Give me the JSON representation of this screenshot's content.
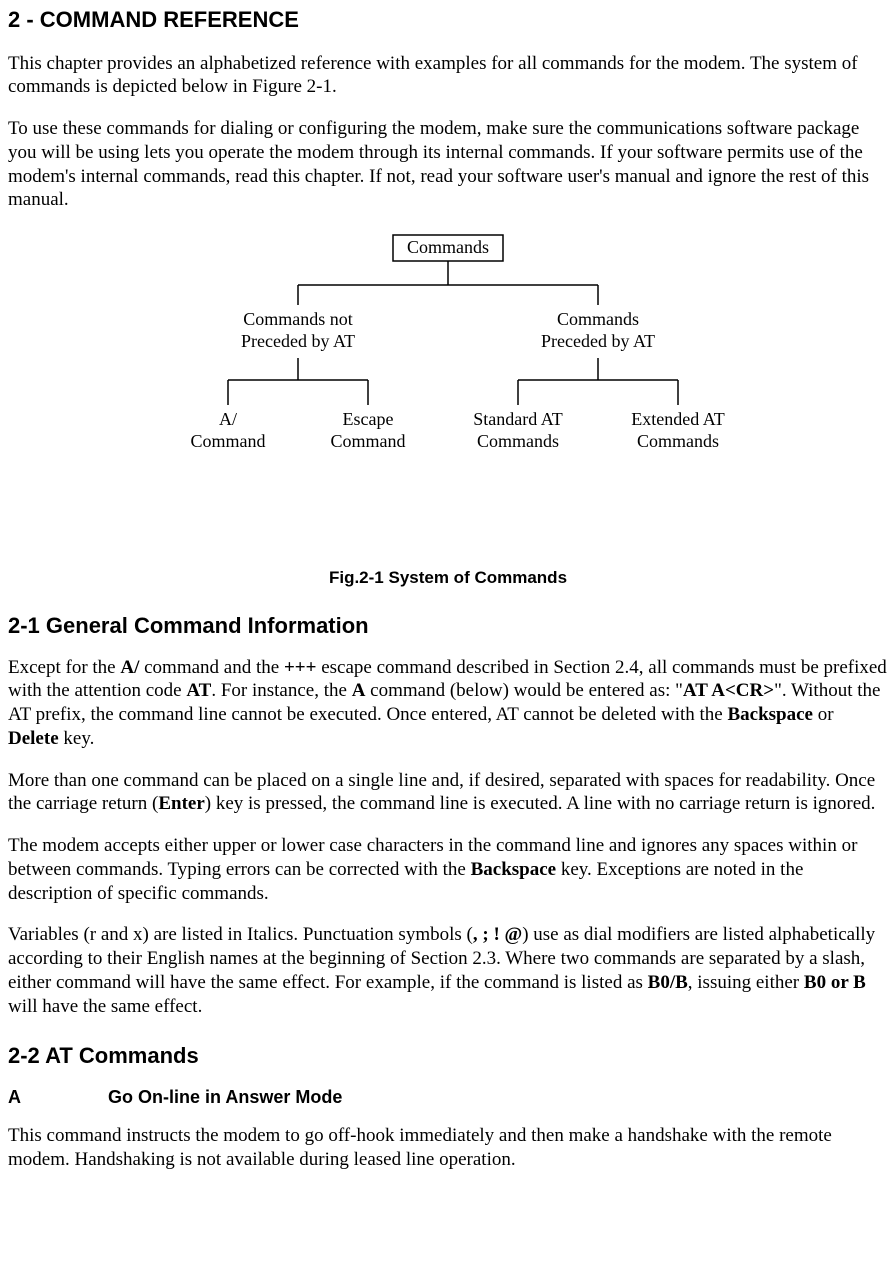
{
  "chapter": {
    "title": "2 - COMMAND REFERENCE"
  },
  "intro": {
    "p1": "This chapter provides an alphabetized reference with examples for all commands for the modem. The system of commands is depicted below in Figure 2-1.",
    "p2": "To use these commands for dialing or configuring the modem, make sure the communications software package you will be using lets you operate the modem through its internal commands. If your software permits use of the modem's internal commands, read this chapter. If not, read your software user's manual and ignore the rest of this manual."
  },
  "diagram": {
    "root": "Commands",
    "branch_left_l1": "Commands not",
    "branch_left_l2": "Preceded by AT",
    "branch_right_l1": "Commands",
    "branch_right_l2": "Preceded by AT",
    "leaf1_l1": "A/",
    "leaf1_l2": "Command",
    "leaf2_l1": "Escape",
    "leaf2_l2": "Command",
    "leaf3_l1": "Standard AT",
    "leaf3_l2": "Commands",
    "leaf4_l1": "Extended AT",
    "leaf4_l2": "Commands",
    "caption": "Fig.2-1 System of Commands"
  },
  "section21": {
    "title": "2-1 General Command Information",
    "p1": {
      "t1": "Except for the ",
      "b1": "A/",
      "t2": " command and the ",
      "b2": "+++",
      "t3": " escape command described in Section 2.4, all commands must be prefixed with the attention code ",
      "b3": "AT",
      "t4": ". For instance, the ",
      "b4": "A",
      "t5": " command (below) would be entered as: \"",
      "b5": "AT A<CR>",
      "t6": "\". Without the AT prefix, the command line cannot be executed. Once entered, AT cannot be deleted with the ",
      "b6": "Backspace",
      "t7": " or ",
      "b7": "Delete",
      "t8": " key."
    },
    "p2": {
      "t1": "More than one command can be placed on a single line and, if desired, separated with spaces for readability. Once the carriage return (",
      "b1": "Enter",
      "t2": ") key is pressed, the command line is executed. A line with no carriage return is ignored."
    },
    "p3": {
      "t1": "The modem accepts either upper or lower case characters in the command line and ignores any spaces within or between commands. Typing errors can be corrected with the ",
      "b1": "Backspace",
      "t2": " key. Exceptions are noted in the description of specific commands."
    },
    "p4": {
      "t1": "Variables (r and x) are listed in Italics. Punctuation symbols (",
      "b1": ", ; ! @",
      "t2": ") use as dial modifiers are listed alphabetically according to their English names at the beginning of Section 2.3. Where two commands are separated by a slash, either command will have the same effect. For example, if the command is listed as ",
      "b2": "B0/B",
      "t3": ", issuing either ",
      "b3": "B0 or B",
      "t4": " will have the same effect."
    }
  },
  "section22": {
    "title": "2-2 AT Commands",
    "cmdA": {
      "letter": "A",
      "name": "Go On-line in Answer Mode",
      "desc": "This command instructs the modem to go off-hook immediately and then make a handshake with the remote modem. Handshaking is not available during leased line operation."
    }
  }
}
